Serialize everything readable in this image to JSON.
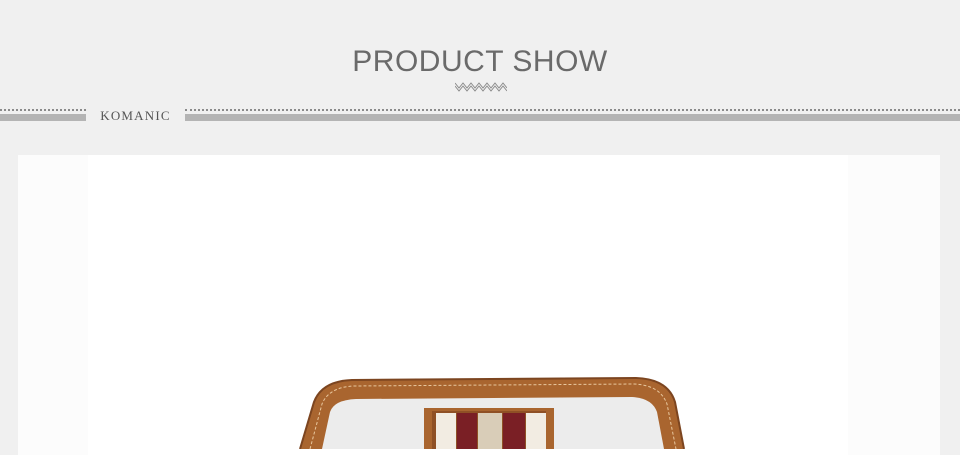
{
  "header": {
    "title": "PRODUCT SHOW",
    "ornament_icon": "zigzag-ornament-icon"
  },
  "divider": {
    "brand": "KOMANIC"
  },
  "product": {
    "image": "brown-leather-handbag-with-striped-strap",
    "colors": {
      "leather": "#a9652f",
      "stripe_red": "#7a1f25",
      "stripe_beige": "#d9cdb8",
      "canvas": "#ececec"
    }
  }
}
